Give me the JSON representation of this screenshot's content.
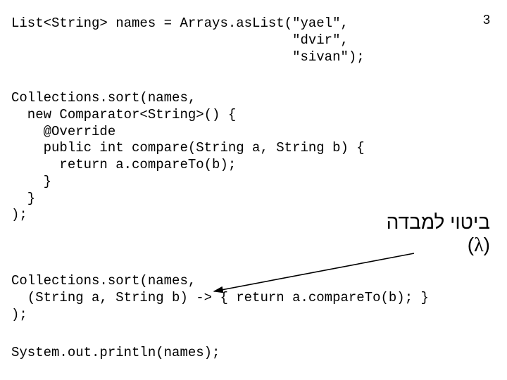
{
  "page_number": "3",
  "code": {
    "block1": "List<String> names = Arrays.asList(\"yael\",\n                                   \"dvir\",\n                                   \"sivan\");",
    "block2": "Collections.sort(names,\n  new Comparator<String>() {\n    @Override\n    public int compare(String a, String b) {\n      return a.compareTo(b);\n    }\n  }\n);",
    "block3": "Collections.sort(names,\n  (String a, String b) -> { return a.compareTo(b); }\n);",
    "block4": "System.out.println(names);"
  },
  "annotation": {
    "line1": "ביטוי למבדה",
    "line2_open": "(",
    "line2_lambda": "λ",
    "line2_close": ")"
  }
}
